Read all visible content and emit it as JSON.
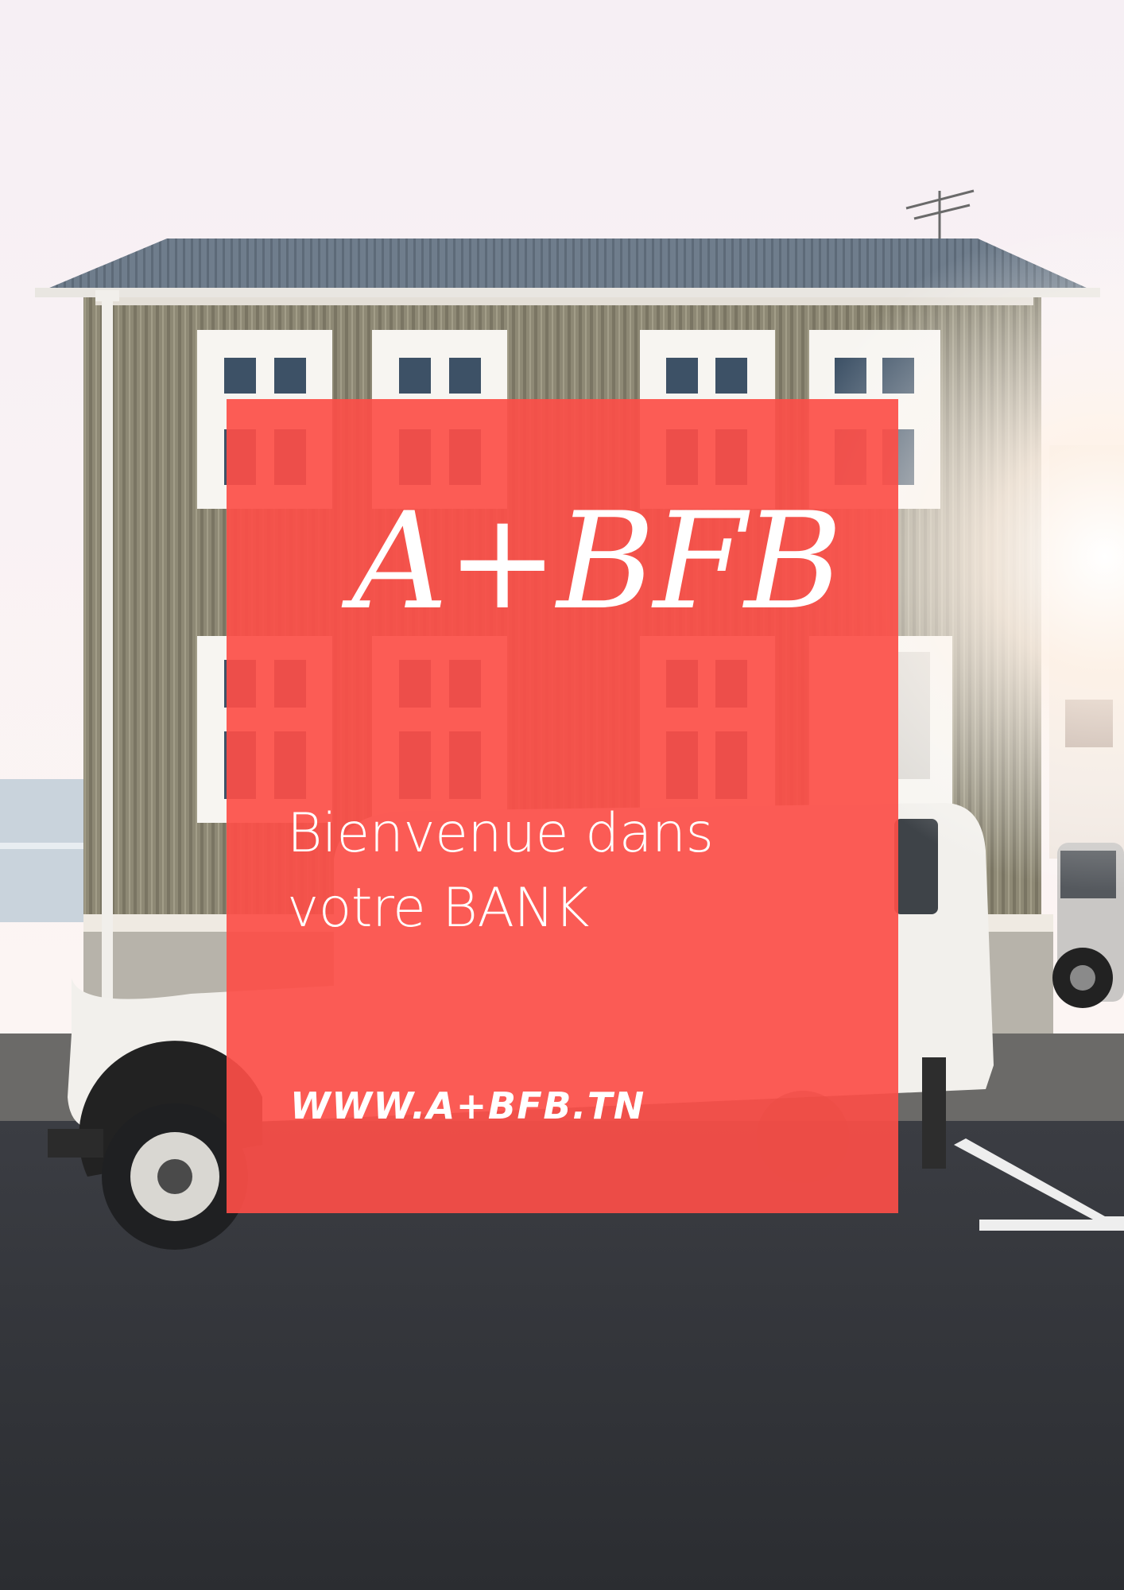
{
  "poster": {
    "brand_logo": "A+BFB",
    "welcome_line_1": "Bienvenue dans",
    "welcome_line_2": "votre BANK",
    "website": "WWW.A+BFB.TN"
  },
  "colors": {
    "card": "#fc4e48",
    "text": "#ffffff",
    "sky": "#fbf3f3",
    "siding": "#8f8a76",
    "roof": "#6d7b8a",
    "road": "#2f3136"
  }
}
